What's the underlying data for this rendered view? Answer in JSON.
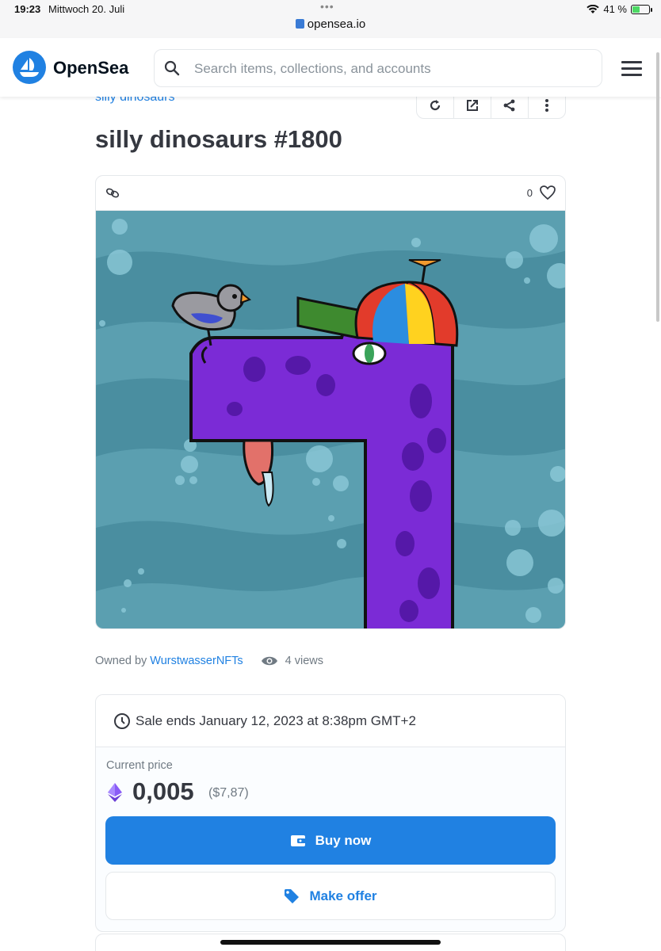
{
  "status_bar": {
    "time": "19:23",
    "date": "Mittwoch 20. Juli",
    "battery_text": "41 %",
    "battery_level": 0.41,
    "dots": "•••"
  },
  "browser": {
    "url": "opensea.io"
  },
  "header": {
    "logo_text": "OpenSea",
    "search_placeholder": "Search items, collections, and accounts"
  },
  "item": {
    "collection": "silly dinosaurs",
    "title": "silly dinosaurs #1800",
    "likes": "0",
    "owner_prefix": "Owned by",
    "owner": "WurstwasserNFTs",
    "views": "4 views"
  },
  "sale": {
    "ends_text": "Sale ends January 12, 2023 at 8:38pm GMT+2",
    "price_label": "Current price",
    "price": "0,005",
    "price_usd": "($7,87)",
    "buy_label": "Buy now",
    "offer_label": "Make offer"
  },
  "colors": {
    "brand_blue": "#2081e2",
    "text_dark": "#353840",
    "text_muted": "#707a83",
    "border": "#e5e8eb"
  },
  "icons": [
    "opensea-logo-icon",
    "search-icon",
    "menu-icon",
    "refresh-icon",
    "external-edit-icon",
    "share-icon",
    "more-icon",
    "chain-link-icon",
    "heart-icon",
    "eye-icon",
    "clock-icon",
    "eth-icon",
    "wallet-icon",
    "tag-icon"
  ]
}
